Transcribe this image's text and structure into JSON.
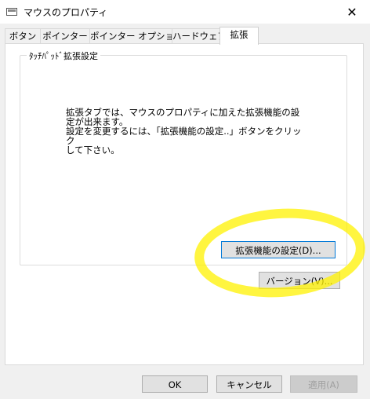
{
  "window": {
    "title": "マウスのプロパティ",
    "close_glyph": "✕"
  },
  "tabs": [
    {
      "label": "ボタン"
    },
    {
      "label": "ポインター"
    },
    {
      "label": "ポインター オプション"
    },
    {
      "label": "ハードウェア"
    },
    {
      "label": "拡張",
      "active": true
    }
  ],
  "group": {
    "label": "ﾀｯﾁﾊﾟｯﾄﾞ拡張設定",
    "description_lines": [
      "拡張タブでは、マウスのプロパティに加えた拡張機能の設",
      "定が出来ます。",
      "設定を変更するには、「拡張機能の設定..」ボタンをクリック",
      "して下さい。"
    ],
    "settings_button": "拡張機能の設定(D)..."
  },
  "version_button": "バージョン(V)...",
  "footer": {
    "ok": "OK",
    "cancel": "キャンセル",
    "apply": "適用(A)"
  },
  "colors": {
    "annotation": "#fff200",
    "focus": "#0078d7"
  }
}
